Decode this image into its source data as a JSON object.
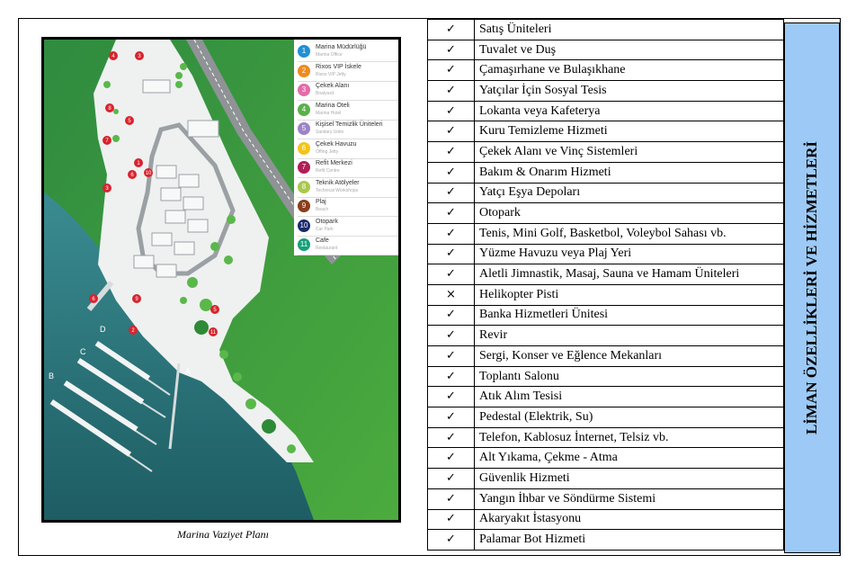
{
  "map": {
    "caption": "Marina Vaziyet Planı",
    "pier_labels": [
      "A",
      "B",
      "C",
      "D"
    ],
    "legend": [
      {
        "num": "1",
        "name": "Marina Müdürlüğü",
        "sub": "Marina Office",
        "color": "#1f8fd6"
      },
      {
        "num": "2",
        "name": "Rixos VIP İskele",
        "sub": "Rixos VIP Jetty",
        "color": "#f08a1c"
      },
      {
        "num": "3",
        "name": "Çekek Alanı",
        "sub": "Boatyard",
        "color": "#e46aa8"
      },
      {
        "num": "4",
        "name": "Marina Oteli",
        "sub": "Marina Hotel",
        "color": "#5cb04a"
      },
      {
        "num": "5",
        "name": "Kişisel Temizlik Üniteleri",
        "sub": "Sanitary Units",
        "color": "#9b84c6"
      },
      {
        "num": "6",
        "name": "Çekek Havuzu",
        "sub": "Offing Jetty",
        "color": "#f2c41c"
      },
      {
        "num": "7",
        "name": "Refit Merkezi",
        "sub": "Refit Centre",
        "color": "#b01e55"
      },
      {
        "num": "8",
        "name": "Teknik Atölyeler",
        "sub": "Technical Workshops",
        "color": "#a9c94a"
      },
      {
        "num": "9",
        "name": "Plaj",
        "sub": "Beach",
        "color": "#8a3d1c"
      },
      {
        "num": "10",
        "name": "Otopark",
        "sub": "Car Park",
        "color": "#1a2a6c"
      },
      {
        "num": "11",
        "name": "Cafe",
        "sub": "Restaurant",
        "color": "#16a07a"
      }
    ],
    "markers": [
      "4",
      "3",
      "8",
      "5",
      "7",
      "1",
      "10",
      "6",
      "3",
      "6",
      "9",
      "2",
      "5",
      "11"
    ]
  },
  "services": {
    "title": "LİMAN ÖZELLİKLERİ VE HİZMETLERİ",
    "items": [
      {
        "mark": "✓",
        "label": "Satış Üniteleri"
      },
      {
        "mark": "✓",
        "label": "Tuvalet ve Duş"
      },
      {
        "mark": "✓",
        "label": "Çamaşırhane ve Bulaşıkhane"
      },
      {
        "mark": "✓",
        "label": "Yatçılar İçin Sosyal Tesis"
      },
      {
        "mark": "✓",
        "label": "Lokanta veya Kafeterya"
      },
      {
        "mark": "✓",
        "label": "Kuru Temizleme Hizmeti"
      },
      {
        "mark": "✓",
        "label": "Çekek Alanı ve Vinç Sistemleri"
      },
      {
        "mark": "✓",
        "label": "Bakım & Onarım Hizmeti"
      },
      {
        "mark": "✓",
        "label": "Yatçı Eşya Depoları"
      },
      {
        "mark": "✓",
        "label": "Otopark"
      },
      {
        "mark": "✓",
        "label": "Tenis, Mini Golf, Basketbol, Voleybol Sahası vb."
      },
      {
        "mark": "✓",
        "label": "Yüzme Havuzu veya Plaj Yeri"
      },
      {
        "mark": "✓",
        "label": "Aletli Jimnastik, Masaj, Sauna ve Hamam Üniteleri"
      },
      {
        "mark": "×",
        "label": "Helikopter Pisti"
      },
      {
        "mark": "✓",
        "label": "Banka Hizmetleri Ünitesi"
      },
      {
        "mark": "✓",
        "label": "Revir"
      },
      {
        "mark": "✓",
        "label": "Sergi, Konser ve Eğlence Mekanları"
      },
      {
        "mark": "✓",
        "label": "Toplantı Salonu"
      },
      {
        "mark": "✓",
        "label": "Atık Alım Tesisi"
      },
      {
        "mark": "✓",
        "label": "Pedestal (Elektrik, Su)"
      },
      {
        "mark": "✓",
        "label": "Telefon, Kablosuz İnternet, Telsiz vb."
      },
      {
        "mark": "✓",
        "label": "Alt Yıkama, Çekme - Atma"
      },
      {
        "mark": "✓",
        "label": "Güvenlik Hizmeti"
      },
      {
        "mark": "✓",
        "label": "Yangın İhbar ve Söndürme Sistemi"
      },
      {
        "mark": "✓",
        "label": "Akaryakıt İstasyonu"
      },
      {
        "mark": "✓",
        "label": "Palamar Bot Hizmeti"
      }
    ]
  }
}
